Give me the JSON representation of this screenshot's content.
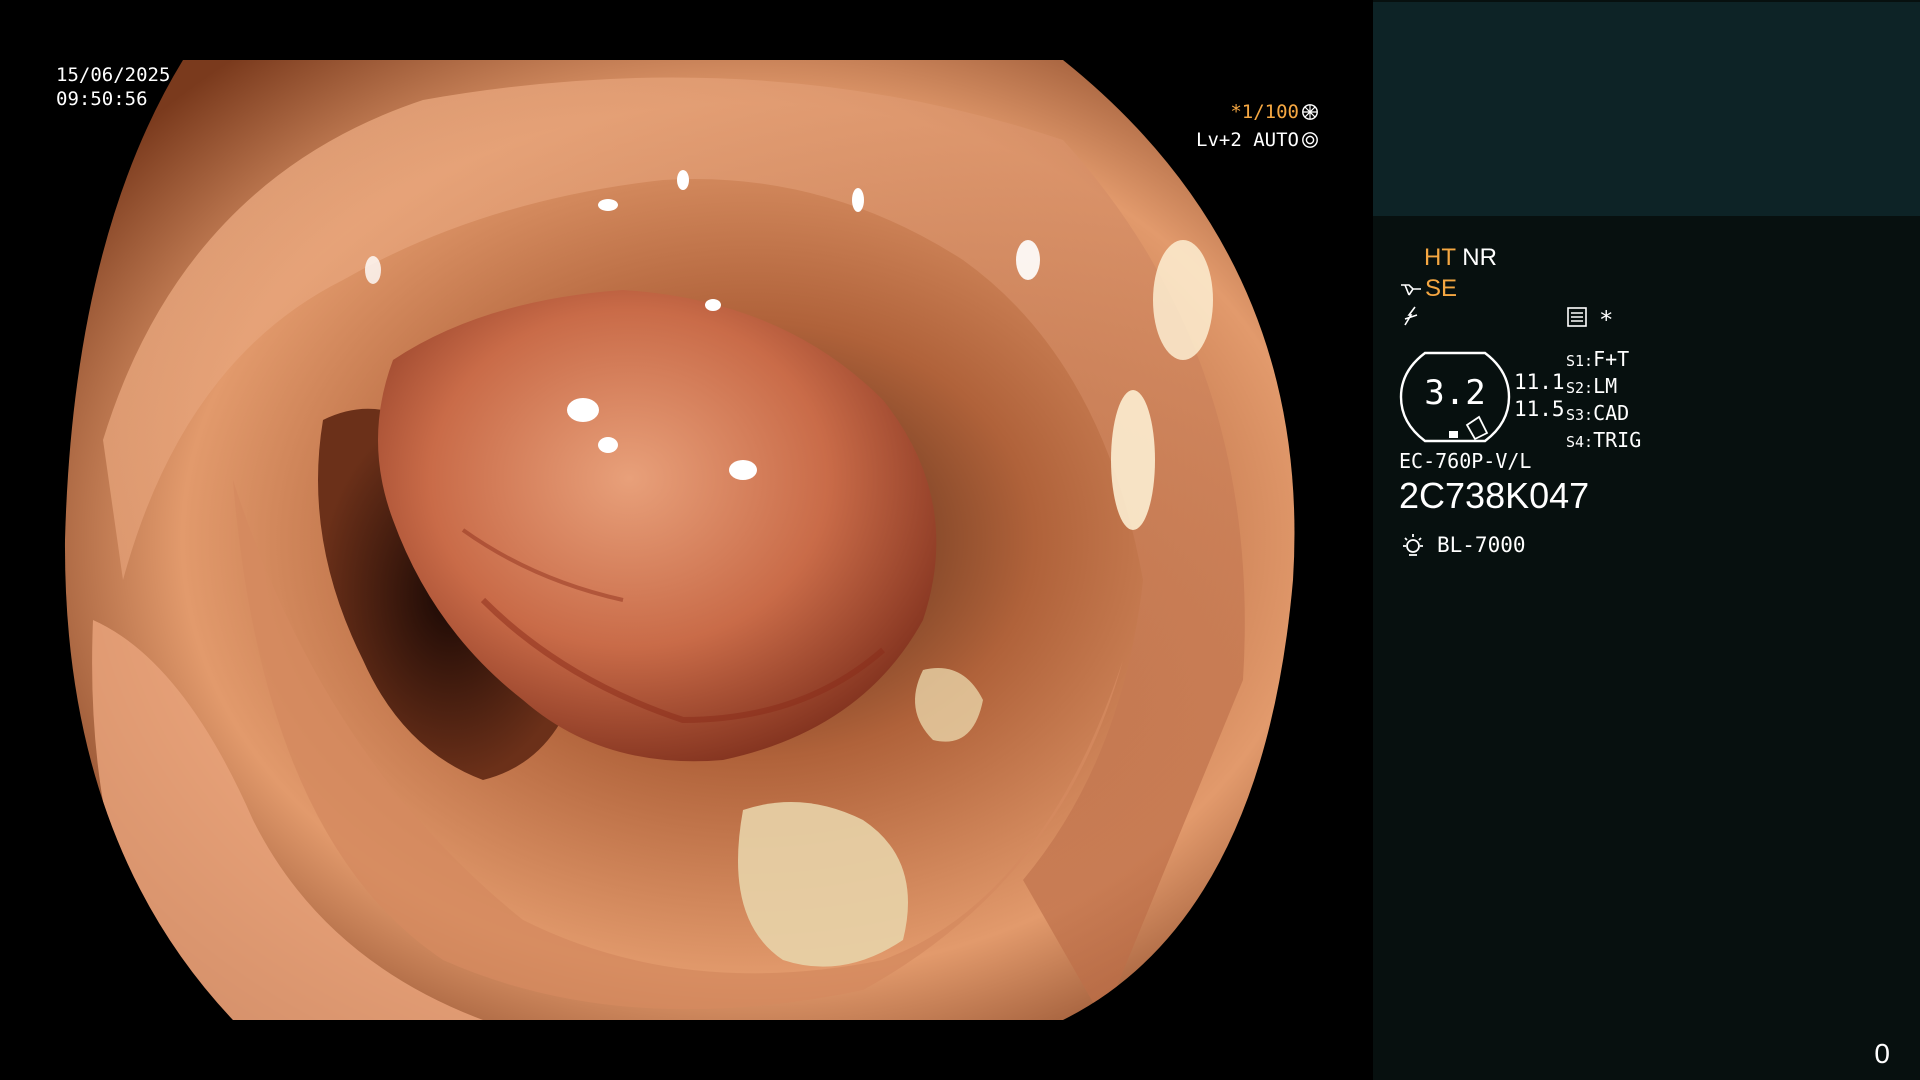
{
  "datetime": {
    "date": "15/06/2025",
    "time": "09:50:56"
  },
  "shutter": {
    "value": "*1/100",
    "level": "Lv+2 AUTO"
  },
  "panel": {
    "ht": "HT",
    "nr": "NR",
    "se": "SE",
    "memo_star": "*",
    "scale": "3.2",
    "num1": "11.1",
    "num2": "11.5",
    "s_items": [
      {
        "key": "S1:",
        "val": "F+T"
      },
      {
        "key": "S2:",
        "val": "LM"
      },
      {
        "key": "S3:",
        "val": "CAD"
      },
      {
        "key": "S4:",
        "val": "TRIG"
      }
    ],
    "scope_model": "EC-760P-V/L",
    "serial": "2C738K047",
    "light_source": "BL-7000",
    "counter": "0"
  },
  "colors": {
    "accent_orange": "#f5a742",
    "panel_bg": "#07100f",
    "panel_top": "#0d2326"
  },
  "icons": [
    "shutter-icon",
    "auto-icon",
    "scissors-icon",
    "lightning-icon",
    "memo-icon",
    "lamp-icon"
  ]
}
